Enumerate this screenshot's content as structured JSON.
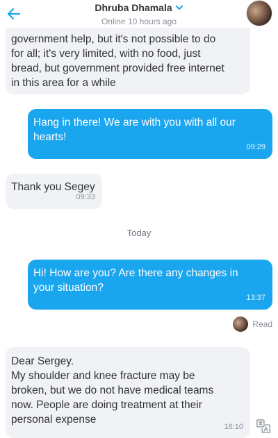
{
  "header": {
    "contact_name": "Dhruba Dhamala",
    "status": "Online 10 hours ago"
  },
  "messages": [
    {
      "direction": "in",
      "lines": [
        "government help, but it's not possible to do",
        "for all; it's very limited, with no food, just",
        "bread, but government provided free internet",
        "in this area for a while"
      ]
    },
    {
      "direction": "out",
      "lines": [
        "Hang in there! We are with you with all our",
        "hearts!"
      ],
      "time": "09:29"
    },
    {
      "direction": "in",
      "lines": [
        "Thank you Segey"
      ],
      "time": "09:33"
    },
    {
      "direction": "out",
      "lines": [
        "Hi! How are you? Are there any changes in",
        "your situation?"
      ],
      "time": "13:37"
    },
    {
      "direction": "in",
      "lines": [
        "Dear Sergey.",
        "My shoulder and knee fracture may be",
        "broken, but we do not have medical teams",
        "now. People are doing treatment at their",
        "personal expense"
      ],
      "time": "16:10"
    }
  ],
  "day_separator": "Today",
  "read_receipt": "Read",
  "colors": {
    "accent": "#1aa5ef",
    "incoming_bubble": "#f1f2f5",
    "outgoing_bubble": "#1aa5ef"
  },
  "icons": {
    "back": "arrow-left-icon",
    "dropdown": "chevron-down-icon",
    "translate": "translate-icon"
  }
}
